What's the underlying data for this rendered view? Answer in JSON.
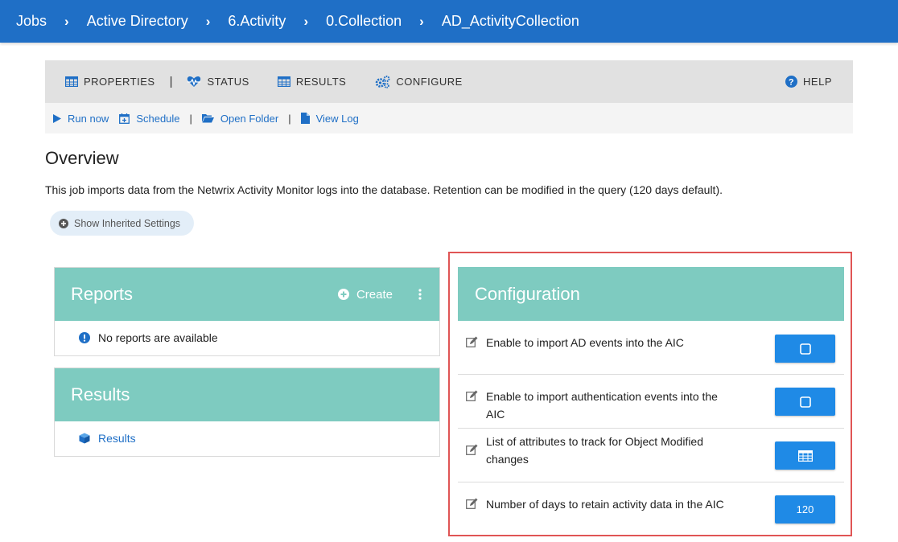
{
  "breadcrumb": [
    "Jobs",
    "Active Directory",
    "6.Activity",
    "0.Collection",
    "AD_ActivityCollection"
  ],
  "tabs": {
    "properties": "PROPERTIES",
    "status": "STATUS",
    "results": "RESULTS",
    "configure": "CONFIGURE",
    "help": "HELP"
  },
  "actions": {
    "run_now": "Run now",
    "schedule": "Schedule",
    "open_folder": "Open Folder",
    "view_log": "View Log"
  },
  "overview": {
    "title": "Overview",
    "description": "This job imports data from the Netwrix Activity Monitor logs into the database. Retention can be modified in the query (120 days default)."
  },
  "show_inherited": "Show Inherited Settings",
  "reports": {
    "title": "Reports",
    "create_label": "Create",
    "empty_message": "No reports are available"
  },
  "results_panel": {
    "title": "Results",
    "link": "Results"
  },
  "configuration": {
    "title": "Configuration",
    "rows": [
      {
        "label": "Enable to import AD events into the AIC",
        "control": "checkbox-icon"
      },
      {
        "label": "Enable to import authentication events into the AIC",
        "control": "checkbox-icon"
      },
      {
        "label": "List of attributes to track for Object Modified changes",
        "control": "table-icon"
      },
      {
        "label": "Number of days to retain activity data in the AIC",
        "value": "120"
      }
    ]
  },
  "colors": {
    "header_blue": "#1f6fc6",
    "panel_teal": "#7ecbc0",
    "button_blue": "#1f8ae6",
    "highlight_red": "#e05555"
  }
}
